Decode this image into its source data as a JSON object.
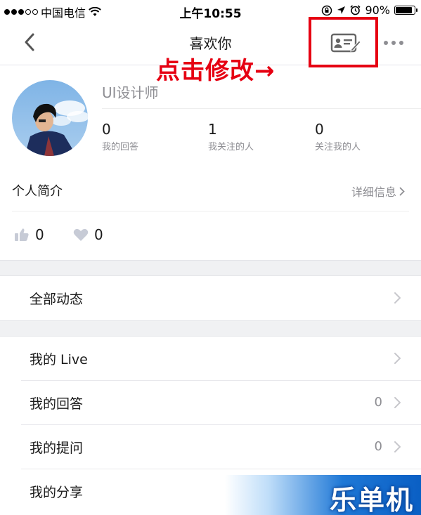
{
  "status_bar": {
    "carrier": "中国电信",
    "time": "上午10:55",
    "battery_text": "90%",
    "battery_level": 0.9,
    "signal_filled": 3,
    "signal_total": 5
  },
  "nav": {
    "title": "喜欢你",
    "back_icon": "chevron-left-icon",
    "edit_icon": "profile-card-edit-icon",
    "more_icon": "more-horizontal-icon"
  },
  "annotation": {
    "text": "点击修改→",
    "color": "#e60012"
  },
  "profile": {
    "name": "UI设计师",
    "stats": [
      {
        "value": "0",
        "label": "我的回答"
      },
      {
        "value": "1",
        "label": "我关注的人"
      },
      {
        "value": "0",
        "label": "关注我的人"
      }
    ],
    "bio_label": "个人简介",
    "bio_detail": "详细信息",
    "likes": "0",
    "thanks": "0"
  },
  "menu": {
    "all_activity": "全部动态",
    "rows": [
      {
        "label": "我的 Live",
        "count": ""
      },
      {
        "label": "我的回答",
        "count": "0"
      },
      {
        "label": "我的提问",
        "count": "0"
      },
      {
        "label": "我的分享",
        "count": ""
      }
    ]
  },
  "watermark": {
    "text": "乐单机"
  },
  "colors": {
    "accent_red": "#e60012",
    "text_primary": "#1a1a1a",
    "text_secondary": "#8e8e93",
    "section_gap": "#f0f1f3"
  }
}
